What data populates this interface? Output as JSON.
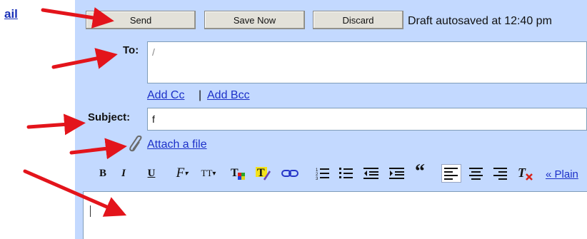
{
  "nav": {
    "link": "ail"
  },
  "buttons": {
    "send": "Send",
    "save_now": "Save Now",
    "discard": "Discard"
  },
  "status": {
    "draft": "Draft autosaved at 12:40 pm"
  },
  "fields": {
    "to_label": "To:",
    "subject_label": "Subject:",
    "subject_value": "f",
    "to_value": "/"
  },
  "links": {
    "add_cc": "Add Cc",
    "separator": "|",
    "add_bcc": "Add Bcc",
    "attach": "Attach a file",
    "plain_text": "« Plain"
  },
  "toolbar": {
    "bold": "B",
    "italic": "I",
    "underline": "U",
    "font": "F",
    "size": "TT",
    "quote": "“"
  },
  "colors": {
    "compose_bg": "#c3d9ff",
    "link": "#1c30c8",
    "arrow": "#e3141b"
  }
}
